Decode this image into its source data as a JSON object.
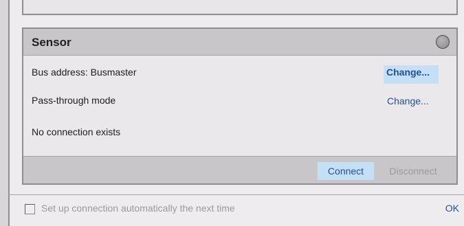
{
  "sensor": {
    "title": "Sensor",
    "status_indicator": "gray-circle-icon",
    "bus_address_label": "Bus address: Busmaster",
    "bus_address_change": "Change...",
    "pass_through_label": "Pass-through mode",
    "pass_through_change": "Change...",
    "connection_status": "No connection exists"
  },
  "actions": {
    "connect": "Connect",
    "disconnect": "Disconnect"
  },
  "bottom": {
    "auto_connect_label": "Set up connection automatically the next time",
    "auto_connect_checked": false,
    "ok": "OK"
  },
  "colors": {
    "link": "#1f4f9e",
    "highlight": "#c5dff6",
    "panel_header": "#c9c6c9",
    "disabled_text": "#9a9a9a"
  }
}
